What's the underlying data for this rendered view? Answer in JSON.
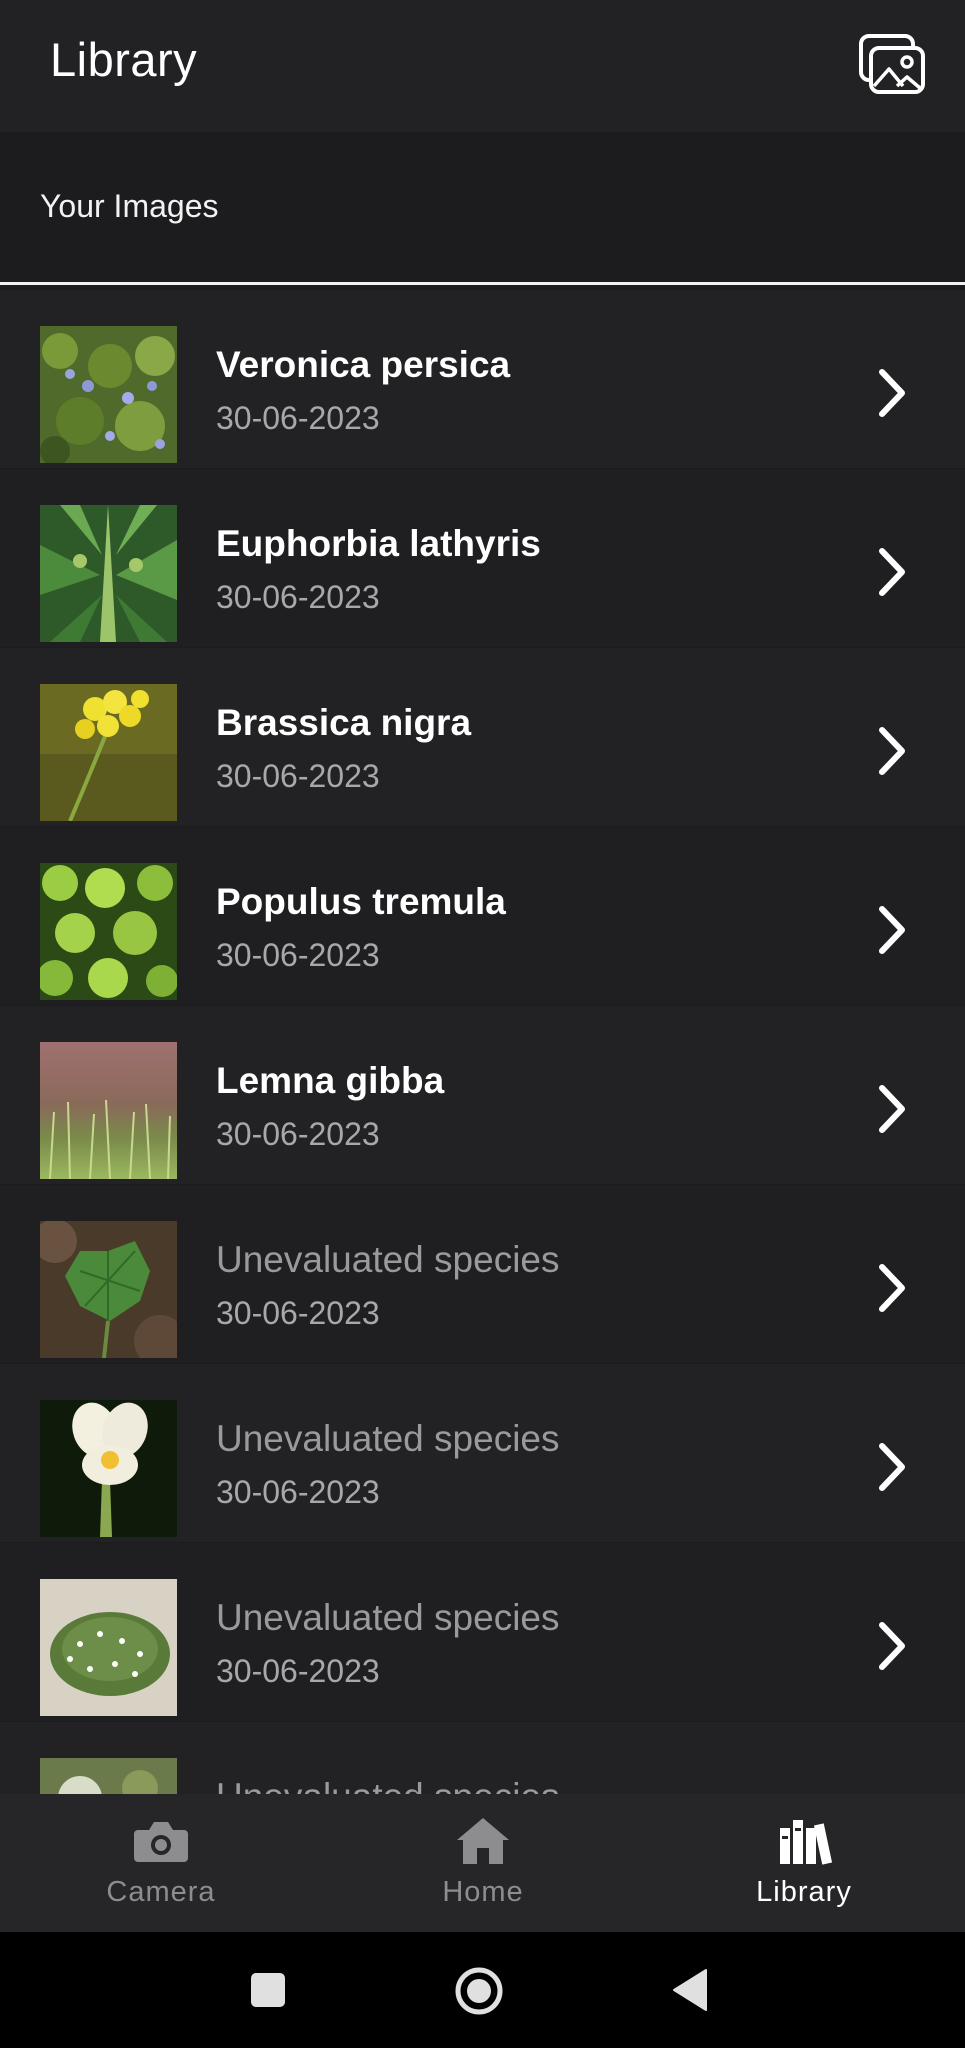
{
  "app_bar": {
    "title": "Library",
    "gallery_icon": "gallery-icon"
  },
  "section": {
    "title": "Your Images"
  },
  "items": [
    {
      "title": "Veronica persica",
      "date": "30-06-2023",
      "evaluated": true
    },
    {
      "title": "Euphorbia lathyris",
      "date": "30-06-2023",
      "evaluated": true
    },
    {
      "title": "Brassica nigra",
      "date": "30-06-2023",
      "evaluated": true
    },
    {
      "title": "Populus tremula",
      "date": "30-06-2023",
      "evaluated": true
    },
    {
      "title": "Lemna gibba",
      "date": "30-06-2023",
      "evaluated": true
    },
    {
      "title": "Unevaluated species",
      "date": "30-06-2023",
      "evaluated": false
    },
    {
      "title": "Unevaluated species",
      "date": "30-06-2023",
      "evaluated": false
    },
    {
      "title": "Unevaluated species",
      "date": "30-06-2023",
      "evaluated": false
    },
    {
      "title": "Unevaluated species",
      "date": "",
      "evaluated": false
    }
  ],
  "bottom_nav": {
    "items": [
      {
        "label": "Camera",
        "icon": "camera-icon",
        "active": false
      },
      {
        "label": "Home",
        "icon": "home-icon",
        "active": false
      },
      {
        "label": "Library",
        "icon": "library-icon",
        "active": true
      }
    ]
  },
  "system_nav": {
    "icons": [
      "recents-icon",
      "home-circle-icon",
      "back-icon"
    ]
  },
  "colors": {
    "background": "#1c1c1e",
    "app_bar": "#222224",
    "text_primary": "#ffffff",
    "text_secondary": "#a8a8aa",
    "nav_inactive": "#8d8d8f"
  }
}
